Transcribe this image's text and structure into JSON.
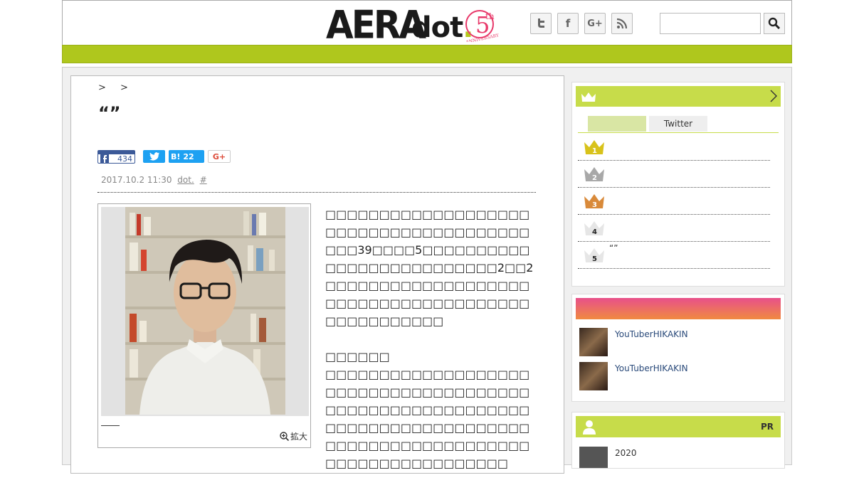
{
  "header": {
    "logo_main": "AERA",
    "logo_sub": "dot",
    "logo_period": ".",
    "anniv_number": "5",
    "anniv_suffix": "th",
    "anniv_text": "ANNIVERSARY",
    "social": [
      {
        "name": "twitter",
        "icon": "twitter-icon",
        "glyph": "t"
      },
      {
        "name": "facebook",
        "icon": "facebook-icon",
        "glyph": "f"
      },
      {
        "name": "googleplus",
        "icon": "googleplus-icon",
        "glyph": "G+"
      },
      {
        "name": "rss",
        "icon": "rss-icon",
        "glyph": ""
      }
    ],
    "search_placeholder": ""
  },
  "colors": {
    "accent_green": "#afc71d",
    "light_green": "#c7dc4a",
    "gold": "#d8c21a",
    "silver": "#a8a8a8",
    "bronze": "#d98a3a"
  },
  "article": {
    "breadcrumb": ">  >",
    "title": "“”",
    "share": {
      "facebook_count": "434",
      "hatena_label": "B!",
      "hatena_count": "22",
      "googleplus_label": "G+"
    },
    "date": "2017.10.2 11:30",
    "source": "dot.",
    "hash": "#",
    "caption": "――",
    "zoom_label": "拡大",
    "paragraphs": [
      "□□□□□□□□□□□□□□□□□□□□□□□□□□□□□□□□□□□□□□□□□39□□□□5□□□□□□□□□□□□□□□□□□□□□□□□□□2□□2□□□□□□□□□□□□□□□□□□□□□□□□□□□□□□□□□□□□□□□□□□□□□□□□□",
      "□□□□□□",
      "□□□□□□□□□□□□□□□□□□□□□□□□□□□□□□□□□□□□□□□□□□□□□□□□□□□□□□□□□□□□□□□□□□□□□□□□□□□□□□□□□□□□□□□□□□□□□□□□□□□□□□□□□□□□□□□□"
    ]
  },
  "ranking": {
    "tabs": [
      "",
      "Twitter"
    ],
    "rows": [
      {
        "rank": "1",
        "title": ""
      },
      {
        "rank": "2",
        "title": ""
      },
      {
        "rank": "3",
        "title": ""
      },
      {
        "rank": "4",
        "title": ""
      },
      {
        "rank": "5",
        "title": "“”"
      }
    ]
  },
  "videos": {
    "items": [
      {
        "label": "YouTuberHIKAKIN"
      },
      {
        "label": "YouTuberHIKAKIN"
      }
    ]
  },
  "pr": {
    "label": "PR",
    "item_text": "2020"
  }
}
